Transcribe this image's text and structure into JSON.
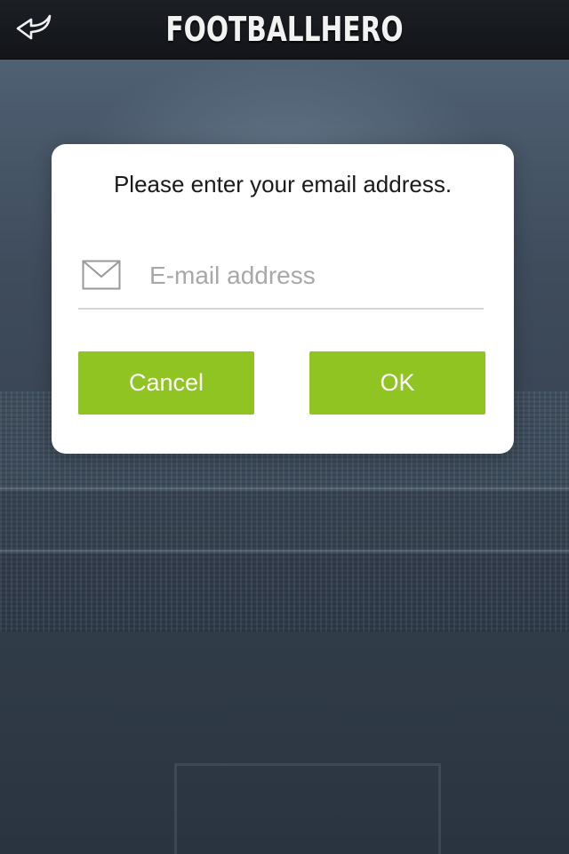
{
  "header": {
    "app_title": "FOOTBALLHERO",
    "back_icon": "back-arrow-icon"
  },
  "dialog": {
    "prompt": "Please enter your email address.",
    "email_field": {
      "icon": "envelope-icon",
      "placeholder": "E-mail address",
      "value": ""
    },
    "cancel_label": "Cancel",
    "ok_label": "OK"
  },
  "colors": {
    "accent_green": "#8fc422",
    "navbar": "#16181c",
    "dialog_bg": "#ffffff"
  }
}
